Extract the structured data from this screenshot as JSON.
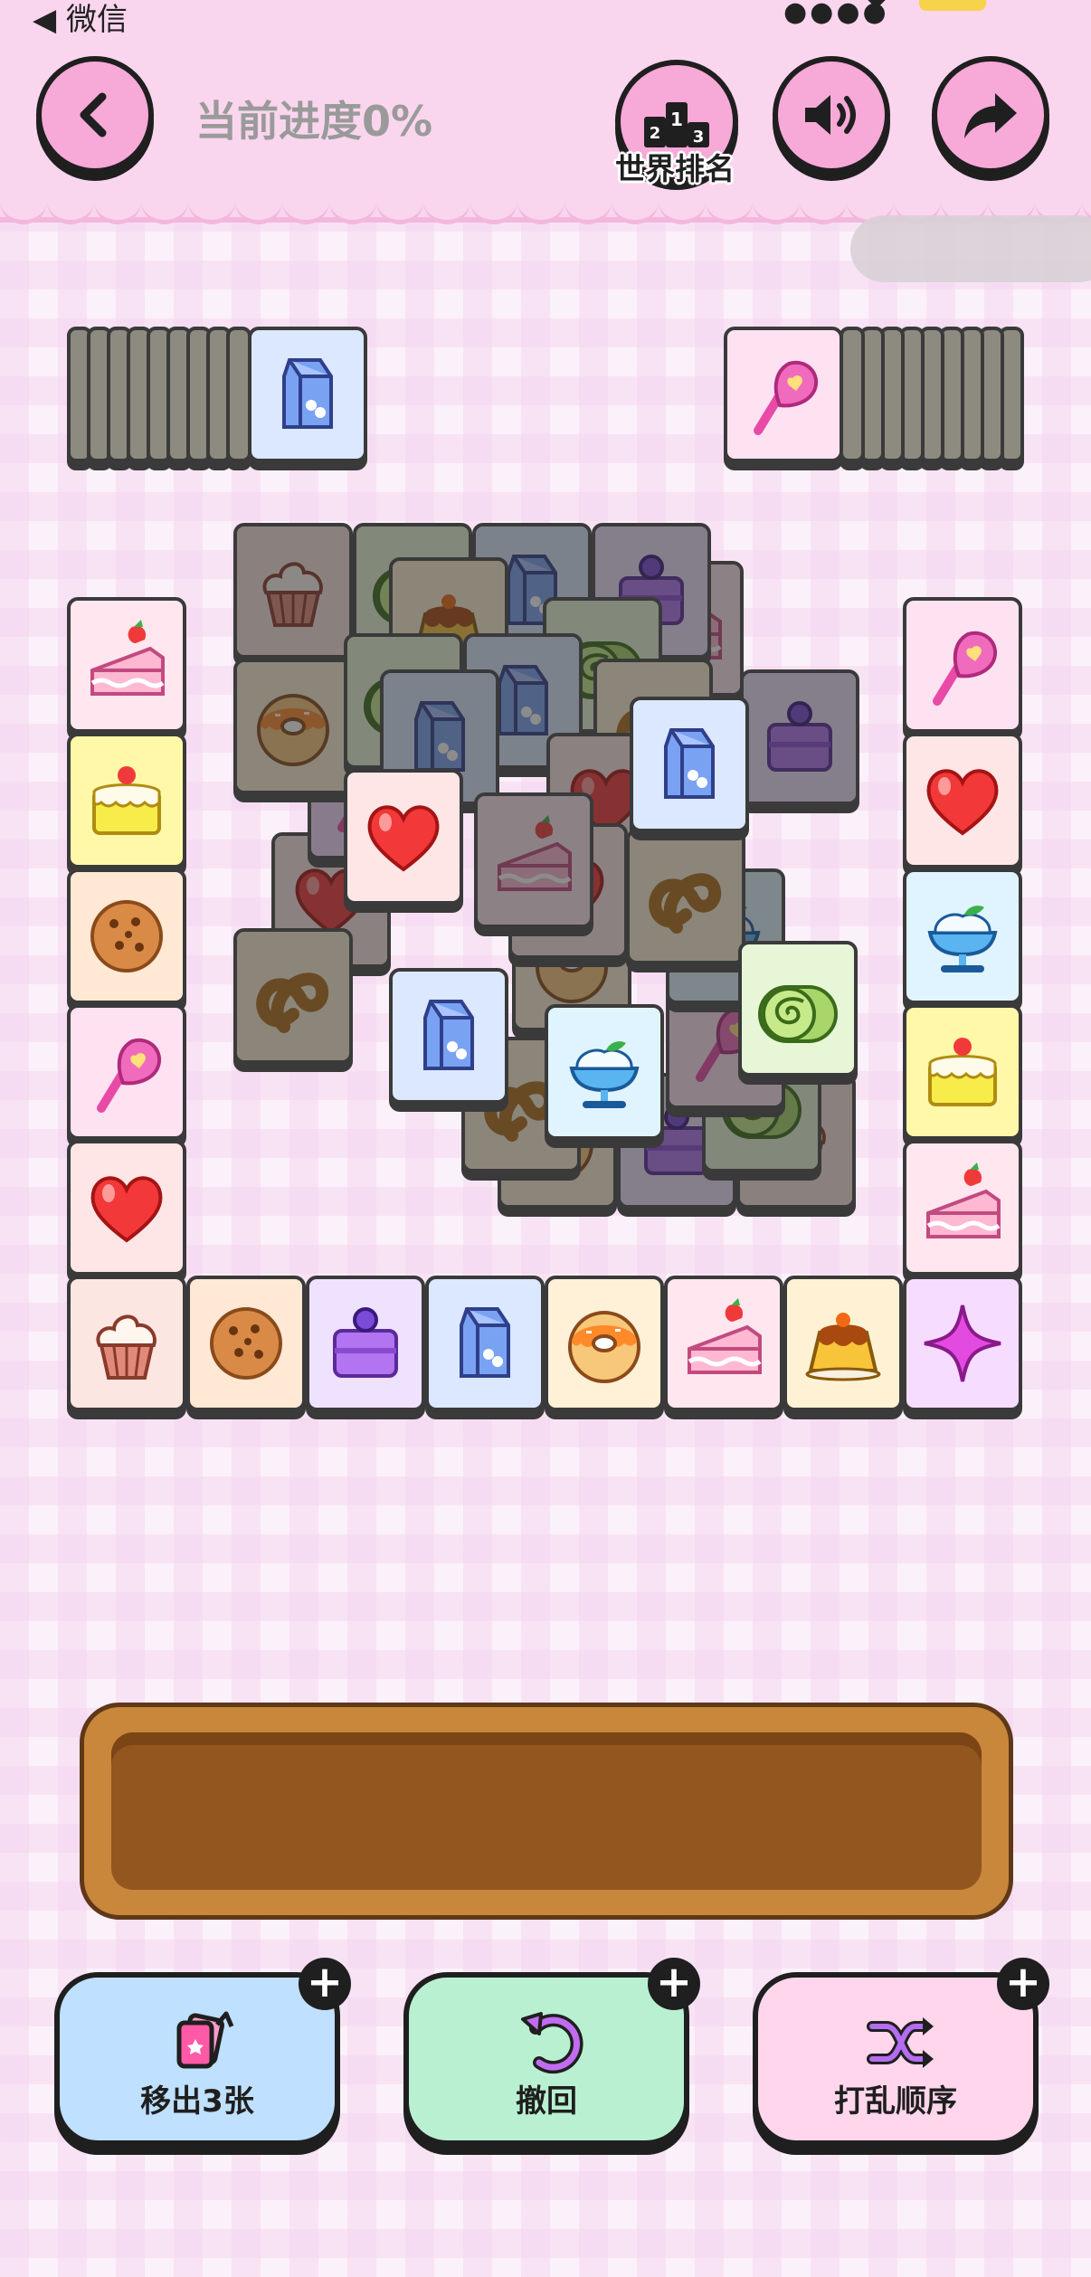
{
  "status_bar": {
    "back_app": "◀ 微信"
  },
  "header": {
    "progress_text": "当前进度0%",
    "rank_label": "世界排名",
    "rank_digits": [
      "2",
      "1",
      "3"
    ]
  },
  "tray": {
    "capacity": 7,
    "filled": 0
  },
  "tools": [
    {
      "label": "移出3张",
      "plus": "+",
      "color": "#bfe0ff"
    },
    {
      "label": "撤回",
      "plus": "+",
      "color": "#b9f0d2"
    },
    {
      "label": "打乱顺序",
      "plus": "+",
      "color": "#ffd6ec"
    }
  ],
  "tiles": {
    "left_stack_top": "milk",
    "right_stack_top": "lollipop",
    "left_column": [
      "cake",
      "yellow-cake",
      "cookie",
      "lollipop",
      "heart"
    ],
    "right_column": [
      "lollipop",
      "heart",
      "icecream",
      "yellow-cake",
      "cake"
    ],
    "bottom_row": [
      "cupcake",
      "cookie",
      "purple-cake",
      "milk",
      "donut",
      "cake",
      "pudding",
      "sparkle"
    ],
    "center_free": [
      "heart",
      "milk",
      "milk",
      "icecream",
      "roll"
    ],
    "center_blocked": [
      "cupcake",
      "roll",
      "milk",
      "purple-cake",
      "pudding",
      "roll",
      "donut",
      "milk",
      "milk",
      "purple-cake",
      "heart",
      "pretzel",
      "cake",
      "pretzel"
    ]
  },
  "colors": {
    "header_bg": "#fad6ee",
    "accent": "#f7a9d8",
    "tray": "#c8873a"
  }
}
